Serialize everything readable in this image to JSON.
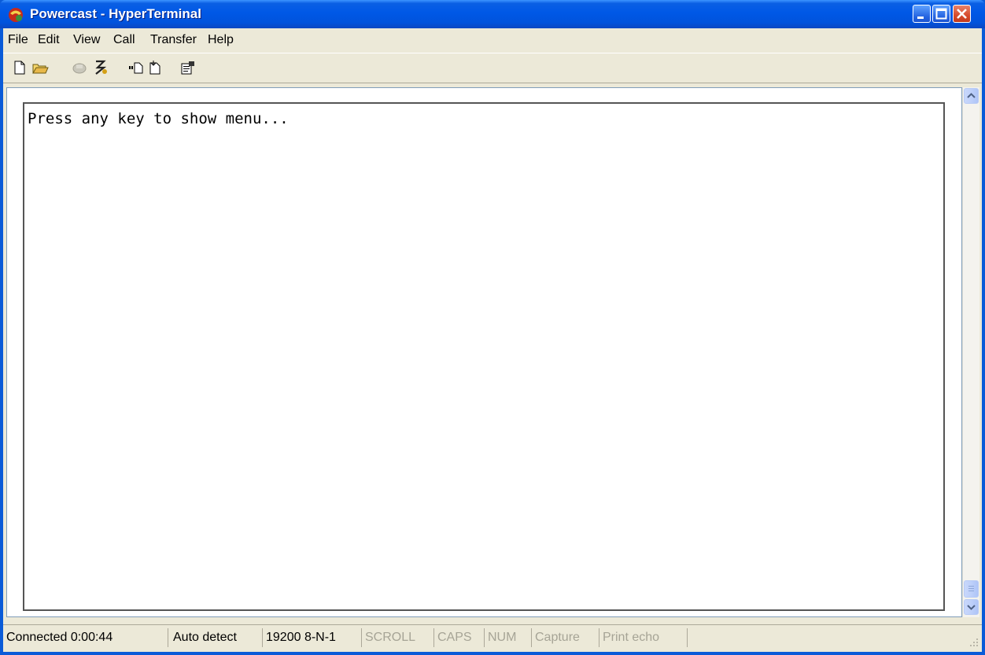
{
  "window": {
    "title": "Powercast - HyperTerminal",
    "app_icon": "hyperterminal-phone-icon"
  },
  "menu": [
    {
      "label": "File"
    },
    {
      "label": "Edit"
    },
    {
      "label": "View"
    },
    {
      "label": "Call"
    },
    {
      "label": "Transfer"
    },
    {
      "label": "Help"
    }
  ],
  "toolbar": [
    {
      "name": "new-icon"
    },
    {
      "name": "open-icon"
    },
    {
      "name": "call-icon"
    },
    {
      "name": "disconnect-icon"
    },
    {
      "name": "send-icon"
    },
    {
      "name": "receive-icon"
    },
    {
      "name": "properties-icon"
    }
  ],
  "terminal": {
    "text": "Press any key to show menu..."
  },
  "status": {
    "connected": "Connected 0:00:44",
    "detect": "Auto detect",
    "settings": "19200 8-N-1",
    "scroll": "SCROLL",
    "caps": "CAPS",
    "num": "NUM",
    "capture": "Capture",
    "print_echo": "Print echo"
  },
  "colors": {
    "titlebar": "#0058e6",
    "face": "#ece9d8",
    "dim_text": "#a6a496"
  }
}
